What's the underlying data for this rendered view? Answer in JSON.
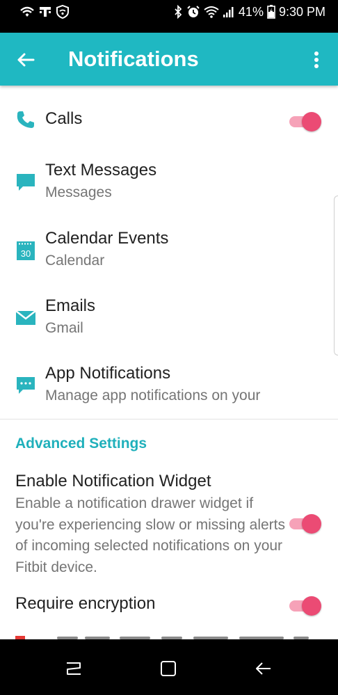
{
  "status_bar": {
    "battery_percent": "41%",
    "time": "9:30 PM"
  },
  "app_bar": {
    "title": "Notifications"
  },
  "notifications": [
    {
      "title": "Calls",
      "subtitle": "",
      "icon": "phone-icon",
      "toggle": true
    },
    {
      "title": "Text Messages",
      "subtitle": "Messages",
      "icon": "message-icon"
    },
    {
      "title": "Calendar Events",
      "subtitle": "Calendar",
      "icon": "calendar-icon",
      "icon_text": "30"
    },
    {
      "title": "Emails",
      "subtitle": "Gmail",
      "icon": "envelope-icon"
    },
    {
      "title": "App Notifications",
      "subtitle": "Manage app notifications on your",
      "icon": "app-chat-icon"
    }
  ],
  "advanced": {
    "header": "Advanced Settings",
    "widget": {
      "title": "Enable Notification Widget",
      "description": "Enable a notification drawer widget if you're experiencing slow or missing alerts of incoming selected notifications on your Fitbit device.",
      "toggle": true
    },
    "encryption": {
      "title": "Require encryption",
      "toggle": true
    }
  },
  "colors": {
    "accent": "#1fb8c2",
    "toggle_on": "#eb4b74",
    "toggle_track": "#f6a2b8"
  }
}
